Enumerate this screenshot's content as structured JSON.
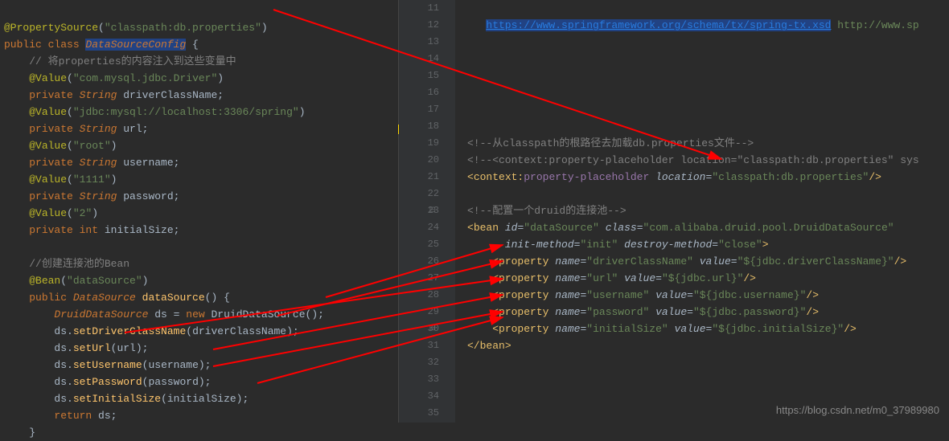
{
  "left": {
    "l1": {
      "ann": "@PropertySource",
      "str": "\"classpath:db.properties\""
    },
    "l2": {
      "kw1": "public class ",
      "cls": "DataSourceConfig",
      "brace": " {"
    },
    "l3": {
      "cmt": "// 将properties的内容注入到这些变量中"
    },
    "l4": {
      "ann": "@Value",
      "str": "\"com.mysql.jdbc.Driver\""
    },
    "l5": {
      "kw": "private ",
      "type": "String",
      "var": " driverClassName;"
    },
    "l6": {
      "ann": "@Value",
      "str": "\"jdbc:mysql://localhost:3306/spring\""
    },
    "l7": {
      "kw": "private ",
      "type": "String",
      "var": " url;"
    },
    "l8": {
      "ann": "@Value",
      "str": "\"root\""
    },
    "l9": {
      "kw": "private ",
      "type": "String",
      "var": " username;"
    },
    "l10": {
      "ann": "@Value",
      "str": "\"1111\""
    },
    "l11": {
      "kw": "private ",
      "type": "String",
      "var": " password;"
    },
    "l12": {
      "ann": "@Value",
      "str": "\"2\""
    },
    "l13": {
      "kw": "private int ",
      "var": "initialSize;"
    },
    "l14": "",
    "l15": {
      "cmt": "//创建连接池的Bean"
    },
    "l16": {
      "ann": "@Bean",
      "str": "\"dataSource\""
    },
    "l17": {
      "kw": "public ",
      "type": "DataSource",
      "meth": " dataSource",
      "rest": "() {"
    },
    "l18": {
      "type": "DruidDataSource",
      "var": " ds ",
      "op": "= ",
      "kw": "new ",
      "ctor": "DruidDataSource",
      "rest": "();"
    },
    "l19": {
      "var": "ds",
      "dot": ".",
      "meth": "setDriverClassName",
      "arg": "(driverClassName);"
    },
    "l20": {
      "var": "ds",
      "dot": ".",
      "meth": "setUrl",
      "arg": "(url);"
    },
    "l21": {
      "var": "ds",
      "dot": ".",
      "meth": "setUsername",
      "arg": "(username);"
    },
    "l22": {
      "var": "ds",
      "dot": ".",
      "meth": "setPassword",
      "arg": "(password);"
    },
    "l23": {
      "var": "ds",
      "dot": ".",
      "meth": "setInitialSize",
      "arg": "(initialSize);"
    },
    "l24": {
      "kw": "return ",
      "var": "ds;"
    },
    "l25": {
      "brace": "}"
    }
  },
  "lineNumbers": [
    "11",
    "12",
    "13",
    "14",
    "15",
    "16",
    "17",
    "18",
    "19",
    "20",
    "21",
    "22",
    "23",
    "24",
    "25",
    "26",
    "27",
    "28",
    "29",
    "30",
    "31",
    "32",
    "33",
    "34",
    "35"
  ],
  "right": {
    "l11": {
      "url": "https://www.springframework.org/schema/tx/spring-tx.xsd",
      "rest": " http://www.sp"
    },
    "l18": {
      "cmt": "<!--从classpath的根路径去加载db.properties文件-->"
    },
    "l19": {
      "cmt": "<!--<context:property-placeholder location=\"classpath:db.properties\" sys"
    },
    "l20": {
      "p1": "<",
      "tag": "context:",
      "tag2": "property-placeholder",
      "sp": " ",
      "attr": "location",
      "eq": "=",
      "val": "\"classpath:db.properties\"",
      "close": "/>"
    },
    "l22": {
      "cmt": "<!--配置一个druid的连接池-->"
    },
    "l23": {
      "p1": "<",
      "tag": "bean",
      "sp": " ",
      "a1": "id",
      "eq1": "=",
      "v1": "\"dataSource\"",
      "sp2": " ",
      "a2": "class",
      "eq2": "=",
      "v2": "\"com.alibaba.druid.pool.DruidDataSource\""
    },
    "l24": {
      "a1": "init-method",
      "eq1": "=",
      "v1": "\"init\"",
      "sp": " ",
      "a2": "destroy-method",
      "eq2": "=",
      "v2": "\"close\"",
      "close": ">"
    },
    "l25": {
      "p1": "<",
      "tag": "property",
      "sp": " ",
      "a1": "name",
      "eq1": "=",
      "v1": "\"driverClassName\"",
      "sp2": " ",
      "a2": "value",
      "eq2": "=",
      "v2": "\"${jdbc.driverClassName}\"",
      "close": "/>"
    },
    "l26": {
      "p1": "<",
      "tag": "property",
      "sp": " ",
      "a1": "name",
      "eq1": "=",
      "v1": "\"url\"",
      "sp2": " ",
      "a2": "value",
      "eq2": "=",
      "v2": "\"${jdbc.url}\"",
      "close": "/>"
    },
    "l27": {
      "p1": "<",
      "tag": "property",
      "sp": " ",
      "a1": "name",
      "eq1": "=",
      "v1": "\"username\"",
      "sp2": " ",
      "a2": "value",
      "eq2": "=",
      "v2": "\"${jdbc.username}\"",
      "close": "/>"
    },
    "l28": {
      "p1": "<",
      "tag": "property",
      "sp": " ",
      "a1": "name",
      "eq1": "=",
      "v1": "\"password\"",
      "sp2": " ",
      "a2": "value",
      "eq2": "=",
      "v2": "\"${jdbc.password}\"",
      "close": "/>"
    },
    "l29": {
      "p1": "<",
      "tag": "property",
      "sp": " ",
      "a1": "name",
      "eq1": "=",
      "v1": "\"initialSize\"",
      "sp2": " ",
      "a2": "value",
      "eq2": "=",
      "v2": "\"${jdbc.initialSize}\"",
      "close": "/>"
    },
    "l30": {
      "p1": "</",
      "tag": "bean",
      "close": ">"
    }
  },
  "watermark": "https://blog.csdn.net/m0_37989980"
}
